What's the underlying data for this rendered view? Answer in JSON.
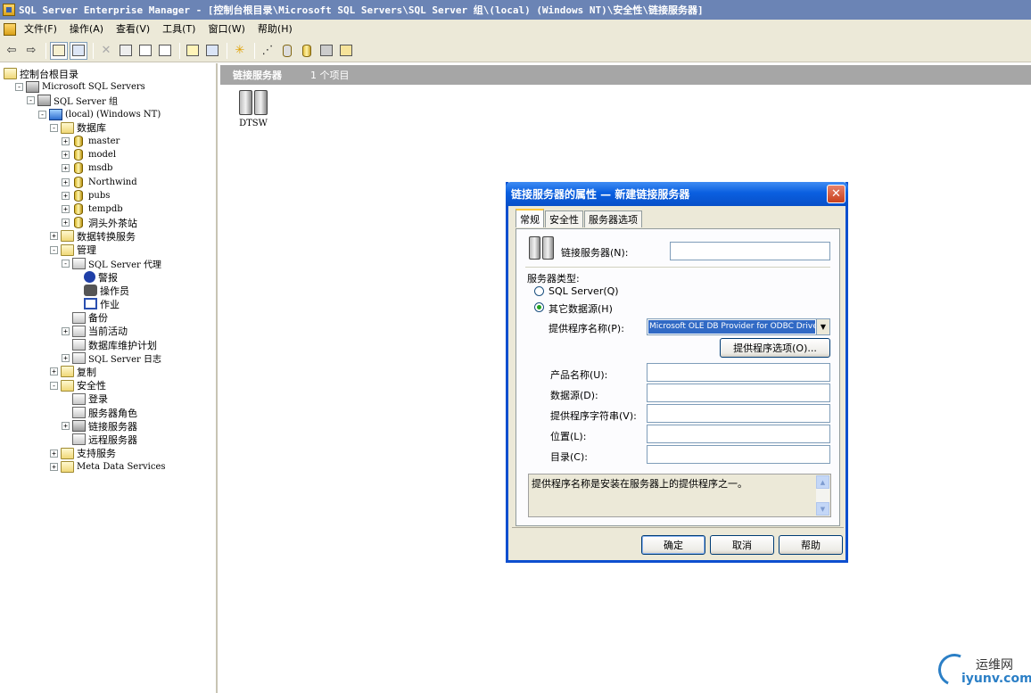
{
  "window": {
    "title": "SQL Server Enterprise Manager - [控制台根目录\\Microsoft SQL Servers\\SQL Server 组\\(local) (Windows NT)\\安全性\\链接服务器]"
  },
  "menubar": [
    "文件(F)",
    "操作(A)",
    "查看(V)",
    "工具(T)",
    "窗口(W)",
    "帮助(H)"
  ],
  "toolbar": {
    "icons": [
      "back-icon",
      "forward-icon",
      "up-folder-icon",
      "show-tree-icon",
      "delete-icon",
      "properties-icon",
      "refresh-icon",
      "export-icon",
      "help-icon",
      "console-icon",
      "new-icon",
      "wizard-icon",
      "query-icon",
      "database-icon",
      "server-icon",
      "folder-open-icon"
    ]
  },
  "tree": {
    "items": [
      {
        "label": "控制台根目录",
        "level": 0,
        "icon": "folder-icon",
        "expand": "none"
      },
      {
        "label": "Microsoft SQL Servers",
        "level": 1,
        "icon": "server-group-icon",
        "expand": "-"
      },
      {
        "label": "SQL Server 组",
        "level": 2,
        "icon": "server-group-icon",
        "expand": "-"
      },
      {
        "label": "(local) (Windows NT)",
        "level": 3,
        "icon": "server-icon",
        "expand": "-"
      },
      {
        "label": "数据库",
        "level": 4,
        "icon": "folder-icon",
        "expand": "-"
      },
      {
        "label": "master",
        "level": 5,
        "icon": "database-icon",
        "expand": "+"
      },
      {
        "label": "model",
        "level": 5,
        "icon": "database-icon",
        "expand": "+"
      },
      {
        "label": "msdb",
        "level": 5,
        "icon": "database-icon",
        "expand": "+"
      },
      {
        "label": "Northwind",
        "level": 5,
        "icon": "database-icon",
        "expand": "+"
      },
      {
        "label": "pubs",
        "level": 5,
        "icon": "database-icon",
        "expand": "+"
      },
      {
        "label": "tempdb",
        "level": 5,
        "icon": "database-icon",
        "expand": "+"
      },
      {
        "label": "洞头外茶站",
        "level": 5,
        "icon": "database-icon",
        "expand": "+"
      },
      {
        "label": "数据转换服务",
        "level": 4,
        "icon": "folder-icon",
        "expand": "+"
      },
      {
        "label": "管理",
        "level": 4,
        "icon": "folder-icon",
        "expand": "-"
      },
      {
        "label": "SQL Server 代理",
        "level": 5,
        "icon": "agent-icon",
        "expand": "-"
      },
      {
        "label": "警报",
        "level": 6,
        "icon": "alert-icon",
        "expand": "none"
      },
      {
        "label": "操作员",
        "level": 6,
        "icon": "operator-icon",
        "expand": "none"
      },
      {
        "label": "作业",
        "level": 6,
        "icon": "job-icon",
        "expand": "none"
      },
      {
        "label": "备份",
        "level": 5,
        "icon": "backup-icon",
        "expand": "none"
      },
      {
        "label": "当前活动",
        "level": 5,
        "icon": "activity-icon",
        "expand": "+"
      },
      {
        "label": "数据库维护计划",
        "level": 5,
        "icon": "maintenance-icon",
        "expand": "none"
      },
      {
        "label": "SQL Server 日志",
        "level": 5,
        "icon": "log-icon",
        "expand": "+"
      },
      {
        "label": "复制",
        "level": 4,
        "icon": "folder-icon",
        "expand": "+"
      },
      {
        "label": "安全性",
        "level": 4,
        "icon": "folder-icon",
        "expand": "-"
      },
      {
        "label": "登录",
        "level": 5,
        "icon": "login-icon",
        "expand": "none"
      },
      {
        "label": "服务器角色",
        "level": 5,
        "icon": "role-icon",
        "expand": "none"
      },
      {
        "label": "链接服务器",
        "level": 5,
        "icon": "linked-server-icon",
        "expand": "+"
      },
      {
        "label": "远程服务器",
        "level": 5,
        "icon": "remote-server-icon",
        "expand": "none"
      },
      {
        "label": "支持服务",
        "level": 4,
        "icon": "folder-icon",
        "expand": "+"
      },
      {
        "label": "Meta Data Services",
        "level": 4,
        "icon": "folder-icon",
        "expand": "+"
      }
    ]
  },
  "right": {
    "header_title": "链接服务器",
    "header_count": "1 个项目",
    "items": [
      {
        "label": "DTSW",
        "icon": "linked-server-icon"
      }
    ]
  },
  "dialog": {
    "title": "链接服务器的属性 — 新建链接服务器",
    "tabs": [
      "常规",
      "安全性",
      "服务器选项"
    ],
    "linked_server_label": "链接服务器(N):",
    "linked_server_value": "",
    "server_type_label": "服务器类型:",
    "radio_sql": "SQL Server(Q)",
    "radio_other": "其它数据源(H)",
    "provider_label": "提供程序名称(P):",
    "provider_value": "Microsoft OLE DB Provider for ODBC Drivers",
    "provider_options_button": "提供程序选项(O)...",
    "product_label": "产品名称(U):",
    "datasource_label": "数据源(D):",
    "provstring_label": "提供程序字符串(V):",
    "location_label": "位置(L):",
    "catalog_label": "目录(C):",
    "description": "提供程序名称是安装在服务器上的提供程序之一。",
    "ok": "确定",
    "cancel": "取消",
    "help": "帮助"
  },
  "watermark": {
    "cn": "运维网",
    "en": "iyunv.com"
  }
}
